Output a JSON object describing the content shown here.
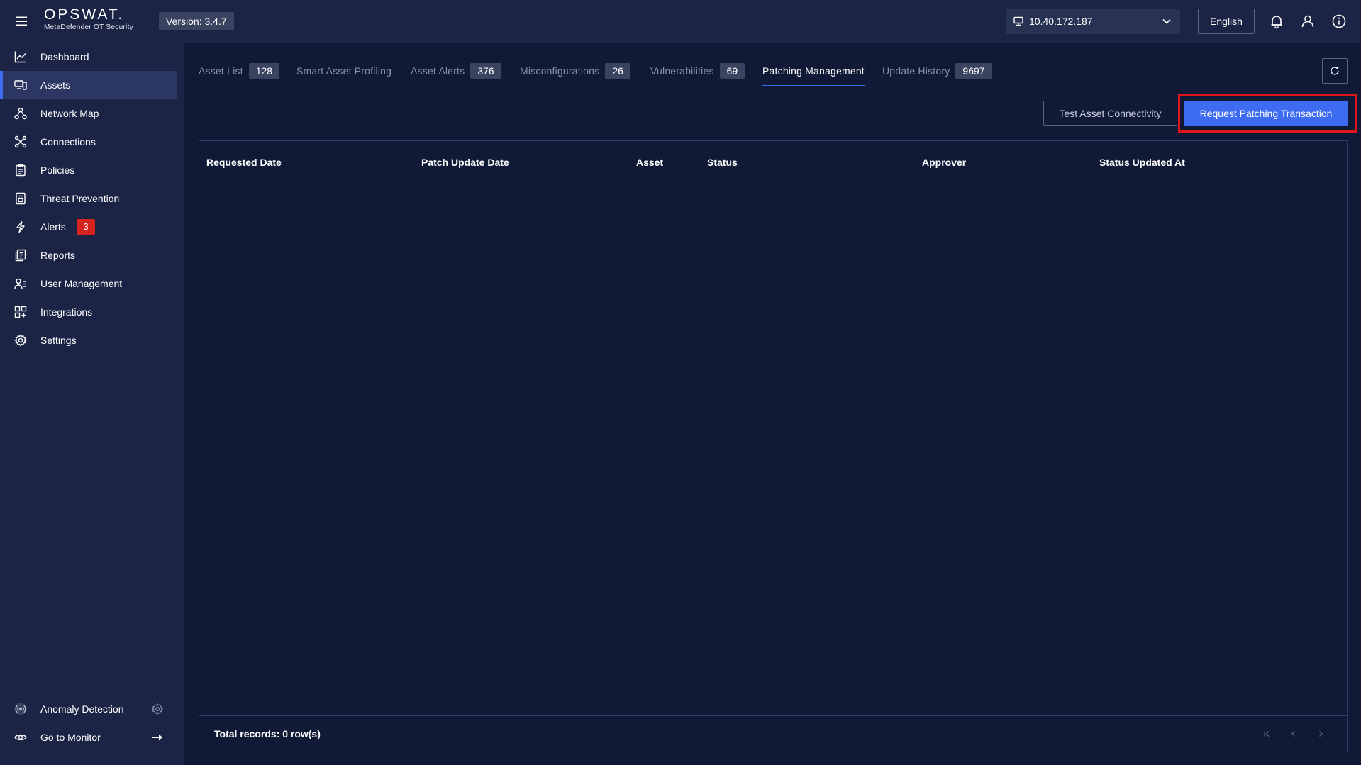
{
  "topbar": {
    "brand_name": "OPSWAT.",
    "brand_sub": "MetaDefender OT Security",
    "version": "Version: 3.4.7",
    "ip": "10.40.172.187",
    "language": "English"
  },
  "sidebar": {
    "items": [
      {
        "label": "Dashboard",
        "icon": "chart-line-icon"
      },
      {
        "label": "Assets",
        "icon": "assets-icon",
        "active": true
      },
      {
        "label": "Network Map",
        "icon": "network-icon"
      },
      {
        "label": "Connections",
        "icon": "connections-icon"
      },
      {
        "label": "Policies",
        "icon": "clipboard-icon"
      },
      {
        "label": "Threat Prevention",
        "icon": "threat-icon"
      },
      {
        "label": "Alerts",
        "icon": "bolt-icon",
        "badge": "3"
      },
      {
        "label": "Reports",
        "icon": "reports-icon"
      },
      {
        "label": "User Management",
        "icon": "user-list-icon"
      },
      {
        "label": "Integrations",
        "icon": "integrations-icon"
      },
      {
        "label": "Settings",
        "icon": "gear-icon"
      }
    ],
    "bottom": {
      "anomaly": "Anomaly Detection",
      "monitor": "Go to Monitor"
    }
  },
  "tabs": [
    {
      "label": "Asset List",
      "count": "128"
    },
    {
      "label": "Smart Asset Profiling"
    },
    {
      "label": "Asset Alerts",
      "count": "376"
    },
    {
      "label": "Misconfigurations",
      "count": "26"
    },
    {
      "label": "Vulnerabilities",
      "count": "69"
    },
    {
      "label": "Patching Management",
      "active": true
    },
    {
      "label": "Update History",
      "count": "9697"
    }
  ],
  "actions": {
    "test": "Test Asset Connectivity",
    "request": "Request Patching Transaction"
  },
  "table": {
    "columns": [
      "Requested Date",
      "Patch Update Date",
      "Asset",
      "Status",
      "Approver",
      "Status Updated At"
    ],
    "rows": [],
    "total": "Total records: 0 row(s)"
  },
  "colors": {
    "background": "#101936",
    "panel": "#1b2445",
    "accent": "#3d6bf2",
    "alert": "#d6231e",
    "highlight": "#e0161a"
  }
}
